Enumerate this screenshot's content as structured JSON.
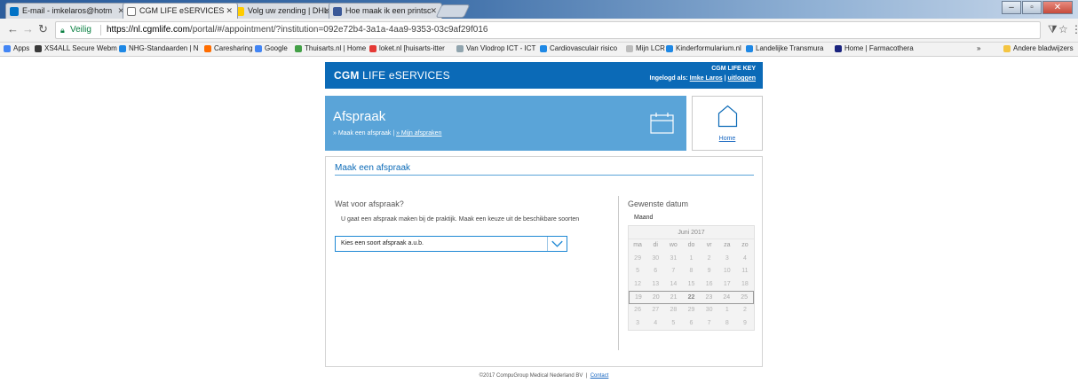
{
  "browser": {
    "tabs": [
      {
        "label": "E-mail - imkelaros@hotm",
        "color": "#0072c6"
      },
      {
        "label": "CGM LIFE eSERVICES",
        "color": "#ffffff"
      },
      {
        "label": "Volg uw zending | DHL P",
        "color": "#ffcc00"
      },
      {
        "label": "Hoe maak ik een printsc",
        "color": "#3b5998"
      }
    ],
    "secure_label": "Veilig",
    "url_host": "https://nl.cgmlife.com",
    "url_path": "/portal/#/appointment/?institution=092e72b4-3a1a-4aa9-9353-03c9af29f016",
    "bookmarks": [
      {
        "label": "Apps",
        "color": "#4285f4"
      },
      {
        "label": "XS4ALL Secure Webm",
        "color": "#3a3a3a"
      },
      {
        "label": "NHG-Standaarden | N",
        "color": "#1e88e5"
      },
      {
        "label": "Caresharing",
        "color": "#ff6d00"
      },
      {
        "label": "Google",
        "color": "#4285f4"
      },
      {
        "label": "Thuisarts.nl | Home",
        "color": "#43a047"
      },
      {
        "label": "loket.nl [huisarts-itter",
        "color": "#e53935"
      },
      {
        "label": "Van Vlodrop ICT - ICT",
        "color": "#90a4ae"
      },
      {
        "label": "Cardiovasculair risico",
        "color": "#1e88e5"
      },
      {
        "label": "Mijn LCR",
        "color": "#bdbdbd"
      },
      {
        "label": "Kinderformularium.nl",
        "color": "#1e88e5"
      },
      {
        "label": "Landelijke Transmura",
        "color": "#1e88e5"
      },
      {
        "label": "Home | Farmacothera",
        "color": "#1a237e"
      }
    ],
    "bookmarks_more": "»",
    "other_bookmarks": "Andere bladwijzers"
  },
  "header": {
    "brand_bold": "CGM",
    "brand_rest": "LIFE eSERVICES",
    "key_label": "CGM LIFE KEY",
    "logged_in_as": "Ingelogd als:",
    "user_name": "Imke Laros",
    "separator": "|",
    "logout": "uitloggen"
  },
  "banner": {
    "title": "Afspraak",
    "crumb_prefix": "» Maak een afspraak |",
    "crumb_link": "» Mijn afspraken",
    "home_label": "Home"
  },
  "form": {
    "section_title": "Maak een afspraak",
    "question": "Wat voor afspraak?",
    "description": "U gaat een afspraak maken bij de praktijk. Maak een keuze uit de beschikbare soorten",
    "select_value": "Kies een soort afspraak a.u.b."
  },
  "calendar": {
    "title": "Gewenste datum",
    "mode_label": "Maand",
    "month": "Juni 2017",
    "weekdays": [
      "ma",
      "di",
      "wo",
      "do",
      "vr",
      "za",
      "zo"
    ],
    "weeks": [
      [
        "29",
        "30",
        "31",
        "1",
        "2",
        "3",
        "4"
      ],
      [
        "5",
        "6",
        "7",
        "8",
        "9",
        "10",
        "11"
      ],
      [
        "12",
        "13",
        "14",
        "15",
        "16",
        "17",
        "18"
      ],
      [
        "19",
        "20",
        "21",
        "22",
        "23",
        "24",
        "25"
      ],
      [
        "26",
        "27",
        "28",
        "29",
        "30",
        "1",
        "2"
      ],
      [
        "3",
        "4",
        "5",
        "6",
        "7",
        "8",
        "9"
      ]
    ],
    "current_week_index": 3,
    "today_label": "22"
  },
  "footer": {
    "copyright": "©2017 CompuGroup Medical Nederland BV",
    "separator": "|",
    "contact": "Contact"
  },
  "colors": {
    "header_blue": "#0b6ab7",
    "banner_blue": "#5aa4d8",
    "link_blue": "#1565c0"
  }
}
